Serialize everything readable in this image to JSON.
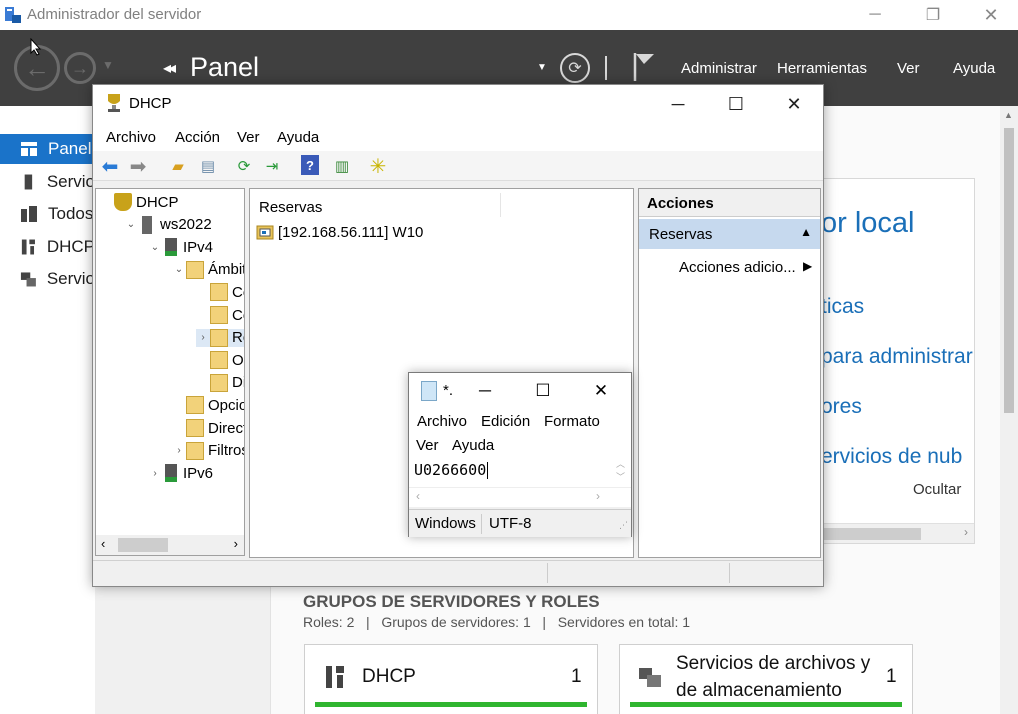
{
  "server_manager": {
    "window_title": "Administrador del servidor",
    "breadcrumb_page": "Panel",
    "header_menu": [
      "Administrar",
      "Herramientas",
      "Ver",
      "Ayuda"
    ],
    "sidebar": [
      {
        "label": "Panel",
        "icon": "dashboard-icon",
        "active": true
      },
      {
        "label": "Servio",
        "icon": "local-server-icon"
      },
      {
        "label": "Todos",
        "icon": "all-servers-icon"
      },
      {
        "label": "DHCP",
        "icon": "dhcp-role-icon"
      },
      {
        "label": "Servio",
        "icon": "file-services-icon"
      }
    ],
    "welcome": {
      "heading": "or local",
      "links": [
        "ticas",
        "para administrar",
        "ores",
        "ervicios de nub"
      ],
      "hide_label": "Ocultar"
    },
    "groups": {
      "title": "GRUPOS DE SERVIDORES Y ROLES",
      "summary": "Roles: 2   |   Grupos de servidores: 1   |   Servidores en total: 1",
      "cards": [
        {
          "name": "DHCP",
          "count": "1"
        },
        {
          "name_line1": "Servicios de archivos y",
          "name_line2": "de almacenamiento",
          "count": "1"
        }
      ]
    }
  },
  "dhcp_window": {
    "title": "DHCP",
    "menu": [
      "Archivo",
      "Acción",
      "Ver",
      "Ayuda"
    ],
    "tree": [
      {
        "label": "DHCP",
        "indent": 0,
        "twisty": ""
      },
      {
        "label": "ws2022",
        "indent": 1,
        "twisty": "⌄"
      },
      {
        "label": "IPv4",
        "indent": 2,
        "twisty": "⌄"
      },
      {
        "label": "Ámbito",
        "indent": 3,
        "twisty": "⌄"
      },
      {
        "label": "Cor",
        "indent": 4,
        "twisty": ""
      },
      {
        "label": "Cor",
        "indent": 4,
        "twisty": ""
      },
      {
        "label": "Res",
        "indent": 4,
        "twisty": "›",
        "selected": true
      },
      {
        "label": "Opc",
        "indent": 4,
        "twisty": ""
      },
      {
        "label": "Dire",
        "indent": 4,
        "twisty": ""
      },
      {
        "label": "Opcior",
        "indent": 3,
        "twisty": ""
      },
      {
        "label": "Directiv",
        "indent": 3,
        "twisty": ""
      },
      {
        "label": "Filtros",
        "indent": 3,
        "twisty": "›"
      },
      {
        "label": "IPv6",
        "indent": 2,
        "twisty": "›"
      }
    ],
    "list": {
      "column": "Reservas",
      "rows": [
        "[192.168.56.111] W10"
      ]
    },
    "actions": {
      "header": "Acciones",
      "selected": "Reservas",
      "more": "Acciones adicio..."
    }
  },
  "notepad": {
    "title": "*.",
    "menu_row1": [
      "Archivo",
      "Edición",
      "Formato"
    ],
    "menu_row2": [
      "Ver",
      "Ayuda"
    ],
    "content": "U0266600",
    "status": [
      "Windows",
      "UTF-8"
    ]
  },
  "colors": {
    "header_bg": "#404040",
    "sidebar_active": "#1a73c9",
    "link_blue": "#1a6fb8",
    "role_green": "#2fb52f",
    "action_selected": "#c6d9ee"
  }
}
